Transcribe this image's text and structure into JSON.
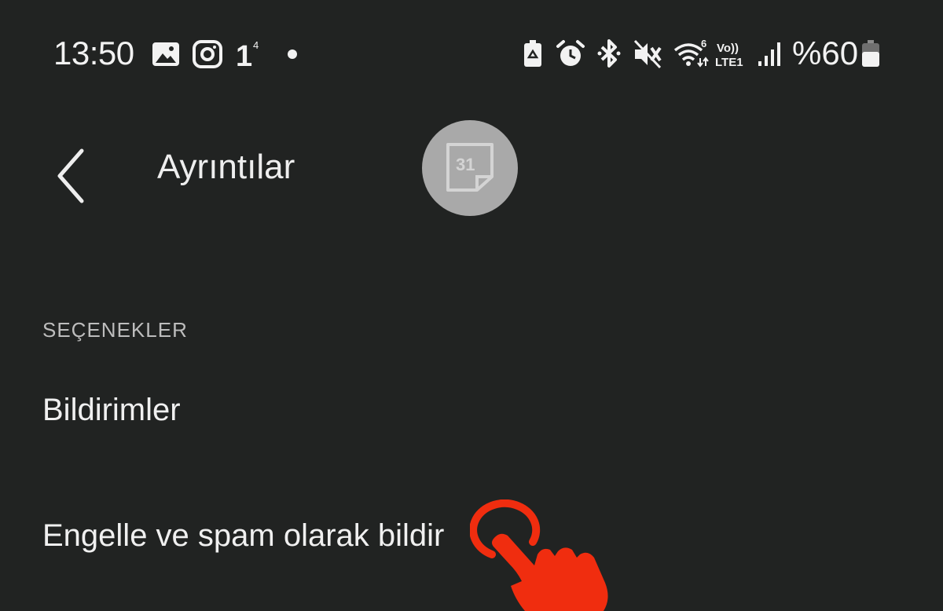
{
  "status_bar": {
    "time": "13:50",
    "battery_percent": "%60",
    "icons_left": [
      "gallery-icon",
      "instagram-icon",
      "notification-count-icon",
      "dot-icon"
    ],
    "icons_right": [
      "battery-saver-icon",
      "alarm-icon",
      "bluetooth-icon",
      "mute-icon",
      "wifi-icon",
      "volte-icon",
      "signal-icon",
      "battery-icon"
    ],
    "volte_label_top": "Vo))",
    "volte_label_bottom": "LTE1",
    "notif_superscript": "4",
    "wifi_superscript": "6"
  },
  "header": {
    "title": "Ayrıntılar",
    "avatar_label": "31",
    "back_icon": "chevron-left-icon"
  },
  "options": {
    "section_title": "SEÇENEKLER",
    "items": [
      {
        "label": "Bildirimler"
      },
      {
        "label": "Engelle ve spam olarak bildir"
      }
    ]
  },
  "overlay": {
    "icon": "tap-hand-icon",
    "color": "#f02d0f"
  },
  "colors": {
    "background": "#212322",
    "text": "#eeeeee",
    "section": "#bdbdbd",
    "avatar": "#a9a9a9"
  }
}
